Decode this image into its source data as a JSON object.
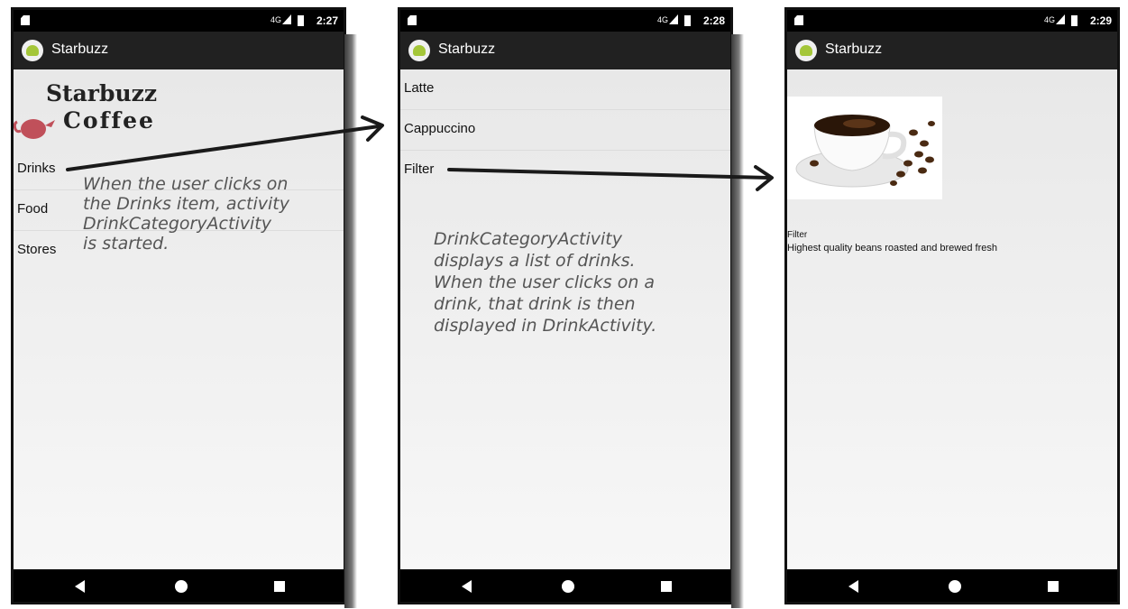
{
  "screens": [
    {
      "status": {
        "network": "4G",
        "time": "2:27"
      },
      "app_title": "Starbuzz",
      "logo_text_top": "Starbuzz",
      "logo_text_bottom": "Coffee",
      "menu_items": [
        "Drinks",
        "Food",
        "Stores"
      ]
    },
    {
      "status": {
        "network": "4G",
        "time": "2:28"
      },
      "app_title": "Starbuzz",
      "drinks": [
        "Latte",
        "Cappuccino",
        "Filter"
      ]
    },
    {
      "status": {
        "network": "4G",
        "time": "2:29"
      },
      "app_title": "Starbuzz",
      "image_icon": "coffee-cup-image",
      "drink_name": "Filter",
      "drink_description": "Highest quality beans roasted and brewed fresh"
    }
  ],
  "annotations": {
    "note1": "When the user clicks on\nthe Drinks item, activity\nDrinkCategoryActivity\nis started.",
    "note2": "DrinkCategoryActivity\ndisplays a list of drinks.\nWhen the user clicks on a\ndrink, that drink is then\ndisplayed in DrinkActivity."
  },
  "colors": {
    "app_bar": "#212121",
    "status_bar": "#000000",
    "android_green": "#a4c639"
  }
}
